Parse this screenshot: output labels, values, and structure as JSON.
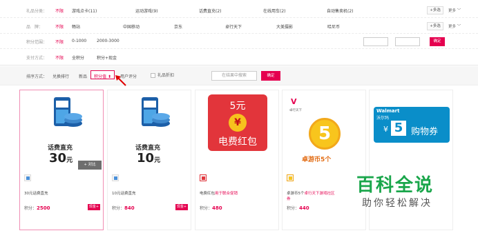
{
  "filters": {
    "rows": [
      {
        "label": "礼品分类：",
        "all": "不限",
        "options": [
          "游戏点卡(11)",
          "运动游戏(9)",
          "话费直充(2)",
          "在线用车(2)",
          "自动售卖机(2)"
        ],
        "multi": "+多选",
        "more": "更多"
      },
      {
        "label": "品　牌：",
        "all": "不限",
        "options": [
          "畅站",
          "中国移动",
          "京东",
          "卓行天下",
          "大美摄影",
          "哈尼币"
        ],
        "multi": "+多选",
        "more": "更多"
      },
      {
        "label": "积分范围：",
        "all": "不限",
        "options": [
          "0-1000",
          "2000-3000"
        ],
        "ok": "确定"
      },
      {
        "label": "支付方式：",
        "all": "不限",
        "options": [
          "全积分",
          "积分+现金"
        ]
      }
    ]
  },
  "sort": {
    "label": "排序方式：",
    "options": [
      "兑换排行",
      "新品",
      "积分值",
      "用户评分"
    ],
    "active_index": 2,
    "checkbox": "礼品折扣",
    "search_placeholder": "在结果中搜索",
    "search_button": "确定"
  },
  "cards": [
    {
      "thumb_title": "话费直充",
      "thumb_value": "30",
      "thumb_unit": "元",
      "name": "30元话费直充",
      "name_highlight": "",
      "points_label": "积分：",
      "points": "2500",
      "cash": "现金+",
      "compare": "+ 对比",
      "selected": true
    },
    {
      "thumb_title": "话费直充",
      "thumb_value": "10",
      "thumb_unit": "元",
      "name": "10元话费直充",
      "name_highlight": "",
      "points_label": "积分：",
      "points": "840",
      "cash": "现金+",
      "selected": false
    },
    {
      "thumb_top": "5元",
      "thumb_coin": "¥",
      "thumb_bottom": "电费红包",
      "name": "电费红包",
      "name_highlight": "用于联合促销",
      "points_label": "积分：",
      "points": "480",
      "selected": false
    },
    {
      "thumb_brand": "卓行天下",
      "thumb_coin": "5",
      "thumb_bottom": "卓游币5个",
      "name": "卓游币5个",
      "name_highlight": "卓行天下游戏社区",
      "name_tail": "券",
      "points_label": "积分：",
      "points": "440",
      "selected": false
    },
    {
      "thumb_brand": "Walmart",
      "thumb_brand_cn": "沃尔玛",
      "thumb_coupon": "购物券",
      "thumb_coin": "5",
      "selected": false
    }
  ],
  "watermark": {
    "line1": "百科全说",
    "line2": "助你轻松解决"
  },
  "colors": {
    "accent": "#e5004f",
    "watermark_green": "#1aa64b"
  }
}
